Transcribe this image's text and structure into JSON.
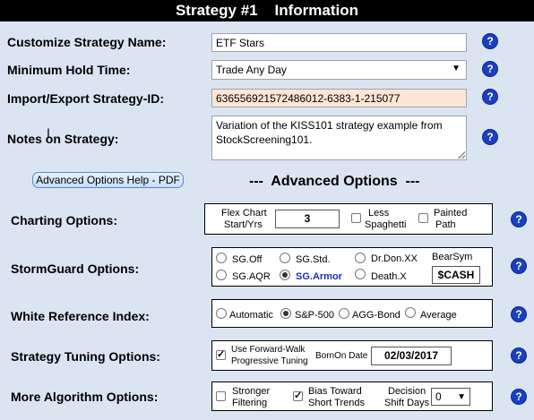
{
  "title": {
    "left": "Strategy #1",
    "right": "Information"
  },
  "fields": {
    "name_label": "Customize Strategy Name:",
    "name_value": "ETF Stars",
    "hold_label": "Minimum Hold Time:",
    "hold_value": "Trade Any Day",
    "import_label": "Import/Export Strategy-ID:",
    "import_value": "636556921572486012-6383-1-215077",
    "notes_label": "Notes on Strategy:",
    "notes_value": "Variation of the KISS101 strategy example from StockScreening101."
  },
  "help_button": "Advanced Options Help - PDF",
  "advanced_heading": "---  Advanced Options  ---",
  "help_icon_text": "?",
  "charting": {
    "label": "Charting Options:",
    "flex_label_1": "Flex Chart",
    "flex_label_2": "Start/Yrs",
    "flex_value": "3",
    "less_1": "Less",
    "less_2": "Spaghetti",
    "painted_1": "Painted",
    "painted_2": "Path"
  },
  "stormguard": {
    "label": "StormGuard Options:",
    "opt_off": "SG.Off",
    "opt_std": "SG.Std.",
    "opt_dr": "Dr.Don.XX",
    "bearsym": "BearSym",
    "opt_aqr": "SG.AQR",
    "opt_armor": "SG.Armor",
    "opt_death": "Death.X",
    "cash": "$CASH"
  },
  "reference": {
    "label": "White Reference Index:",
    "opt_auto": "Automatic",
    "opt_sp": "S&P-500",
    "opt_agg": "AGG-Bond",
    "opt_avg": "Average"
  },
  "tuning": {
    "label": "Strategy Tuning Options:",
    "walk_1": "Use Forward-Walk",
    "walk_2": "Progressive Tuning",
    "born_label": "BornOn Date",
    "born_value": "02/03/2017"
  },
  "algorithm": {
    "label": "More Algorithm Options:",
    "stronger_1": "Stronger",
    "stronger_2": "Filtering",
    "bias_1": "Bias Toward",
    "bias_2": "Short Trends",
    "decision_1": "Decision",
    "decision_2": "Shift Days",
    "shift_value": "0"
  }
}
